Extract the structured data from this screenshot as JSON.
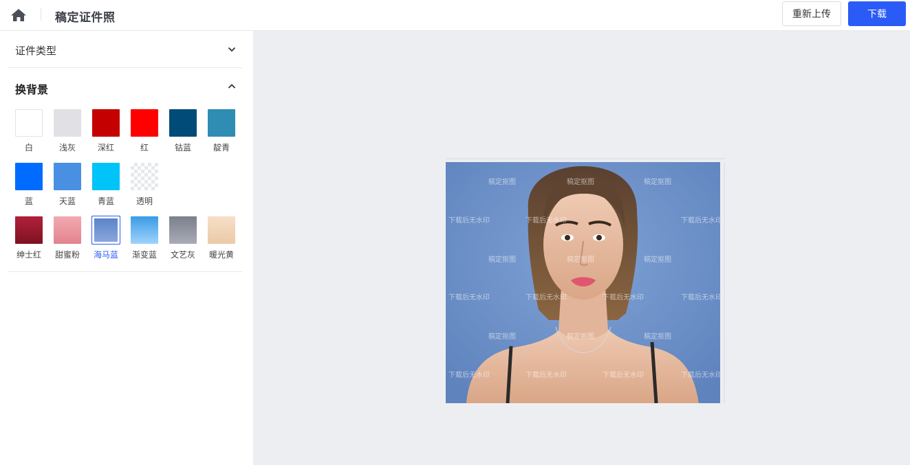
{
  "header": {
    "title": "稿定证件照",
    "reupload_label": "重新上传",
    "download_label": "下载",
    "home_icon": "home-icon"
  },
  "sidebar": {
    "id_type_section": {
      "label": "证件类型",
      "expanded": false
    },
    "background_section": {
      "label": "换背景",
      "expanded": true,
      "selected": "海马蓝",
      "swatches": [
        {
          "label": "白",
          "color": "#ffffff"
        },
        {
          "label": "浅灰",
          "color": "#e1e1e5"
        },
        {
          "label": "深红",
          "color": "#c40000"
        },
        {
          "label": "红",
          "color": "#ff0000"
        },
        {
          "label": "钴蓝",
          "color": "#014b78"
        },
        {
          "label": "靛青",
          "color": "#2f8cb3"
        },
        {
          "label": "蓝",
          "color": "#006cff"
        },
        {
          "label": "天蓝",
          "color": "#4a90e2"
        },
        {
          "label": "青蓝",
          "color": "#00c3f7"
        },
        {
          "label": "透明",
          "color": "transparent"
        },
        {
          "label": "绅士红",
          "color": "#9b1a2a"
        },
        {
          "label": "甜蜜粉",
          "color": "#e9909a"
        },
        {
          "label": "海马蓝",
          "color": "#6b8fd0"
        },
        {
          "label": "渐变蓝",
          "color": "#56a8ec"
        },
        {
          "label": "文艺灰",
          "color": "#8d919e"
        },
        {
          "label": "暖光黄",
          "color": "#f1d4b6"
        }
      ]
    }
  },
  "preview": {
    "watermark_a": "稿定抠图",
    "watermark_b": "下载后无水印",
    "background_color": "#6e93c9"
  },
  "colors": {
    "accent": "#2b5bf6",
    "canvas_bg": "#eceef2"
  }
}
